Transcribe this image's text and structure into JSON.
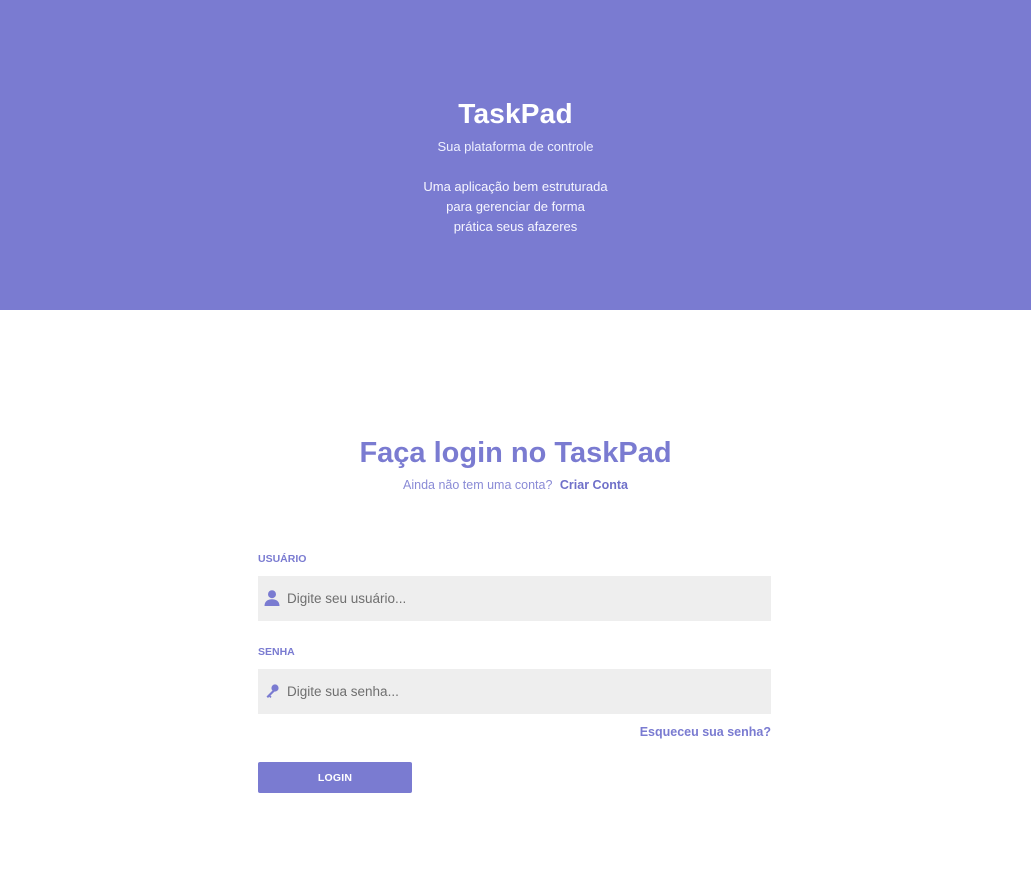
{
  "hero": {
    "title": "TaskPad",
    "subtitle": "Sua plataforma de controle",
    "description_lines": [
      "Uma aplicação bem estruturada",
      "para gerenciar de forma",
      "prática seus afazeres"
    ]
  },
  "login": {
    "title": "Faça login no TaskPad",
    "no_account_text": "Ainda não tem uma conta?",
    "create_account_link": "Criar Conta",
    "user_label": "USUÁRIO",
    "user_placeholder": "Digite seu usuário...",
    "user_value": "",
    "user_icon": "user-icon",
    "password_label": "SENHA",
    "password_placeholder": "Digite sua senha...",
    "password_value": "",
    "password_icon": "key-icon",
    "forgot_password_link": "Esqueceu sua senha?",
    "submit_label": "LOGIN"
  },
  "colors": {
    "primary": "#7a7bd1",
    "field_background": "#eeeeee",
    "page_background": "#ffffff"
  }
}
